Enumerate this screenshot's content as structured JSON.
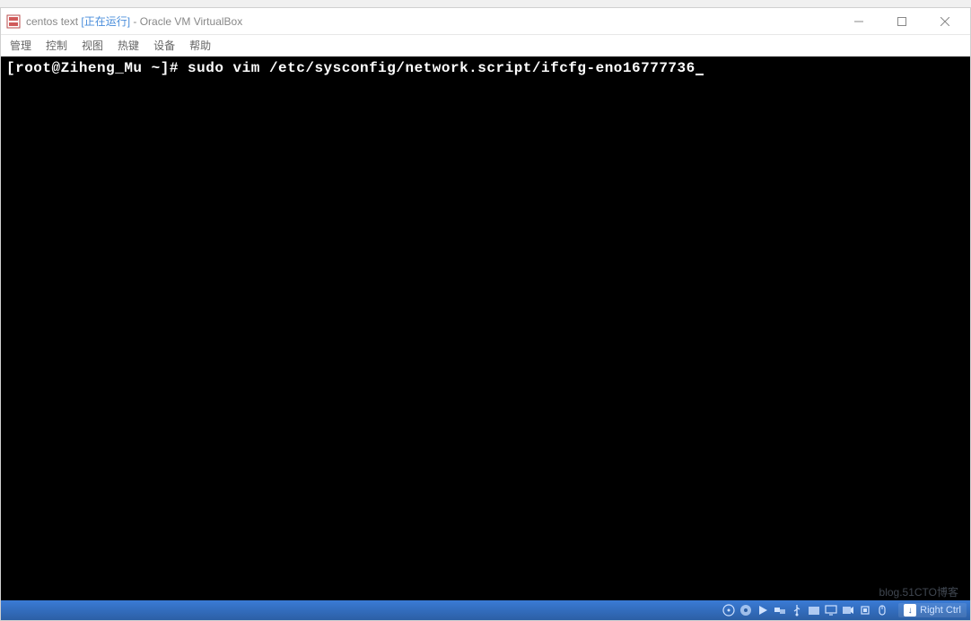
{
  "titlebar": {
    "vm_name": "centos text",
    "running_tag": "[正在运行]",
    "app_suffix": " - Oracle VM VirtualBox"
  },
  "menu": {
    "items": [
      "管理",
      "控制",
      "视图",
      "热键",
      "设备",
      "帮助"
    ]
  },
  "terminal": {
    "prompt": "[root@Ziheng_Mu ~]# ",
    "command": "sudo vim /etc/sysconfig/network.script/ifcfg-eno16777736"
  },
  "statusbar": {
    "host_key": "Right Ctrl",
    "icons": [
      "disc-icon",
      "cd-icon",
      "play-icon",
      "network-icon",
      "usb-icon",
      "folder-icon",
      "display-icon",
      "recording-icon",
      "cpu-icon",
      "mouse-icon"
    ]
  },
  "watermark": "blog.51CTO博客"
}
